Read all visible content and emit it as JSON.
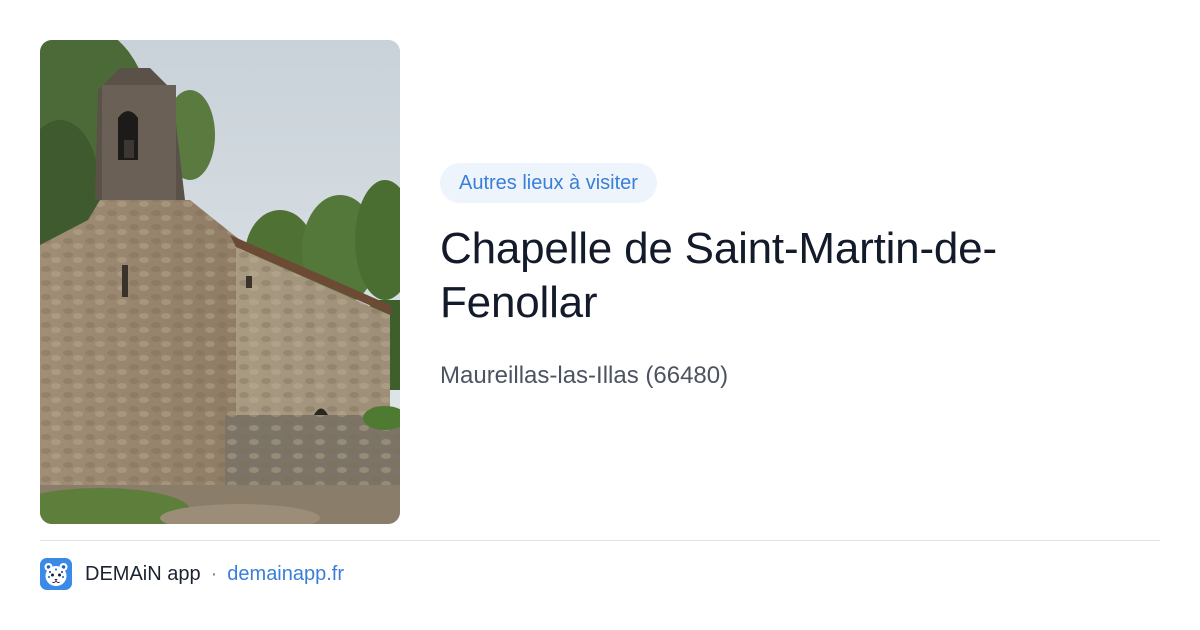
{
  "card": {
    "photo": {
      "alt": "Chapelle de Saint-Martin-de-Fenollar",
      "icon": "stone-chapel-photo"
    },
    "tag_label": "Autres lieux à visiter",
    "title": "Chapelle de Saint-Martin-de-Fenollar",
    "location": "Maureillas-las-Illas (66480)",
    "footer": {
      "app_icon": "leopard-app-icon",
      "app_name": "DEMAiN app",
      "separator": "·",
      "site": "demainapp.fr"
    }
  },
  "colors": {
    "accent": "#3a7ed9",
    "tag_bg": "#eef4fc",
    "title": "#131a29",
    "subtitle": "#4c5462",
    "divider": "#dfe4e8",
    "app_icon_bg": "#3b8ae6"
  }
}
